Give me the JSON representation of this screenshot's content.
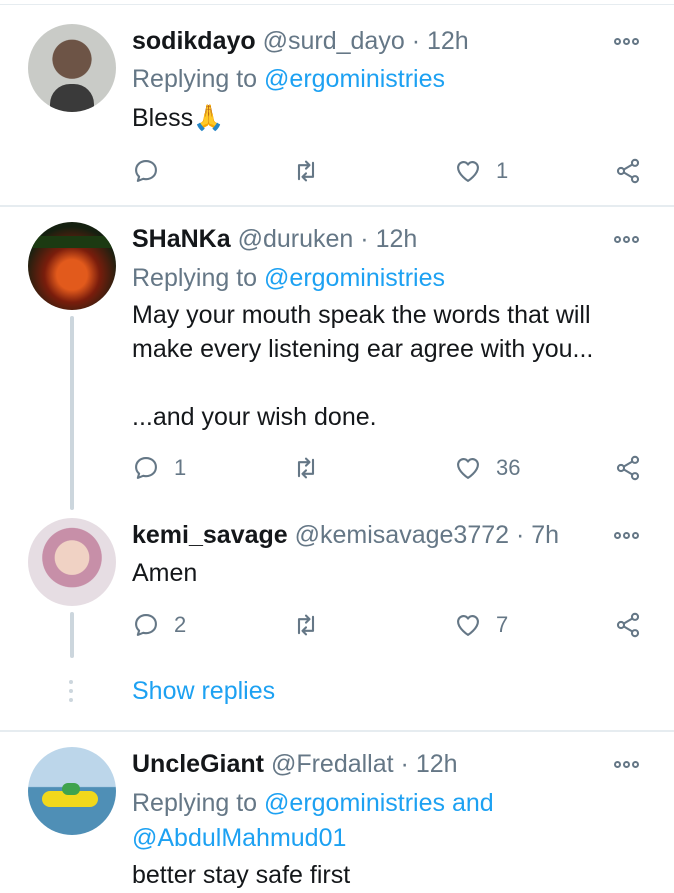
{
  "colors": {
    "accent": "#1da1f2",
    "muted": "#657786",
    "text": "#14171a",
    "border": "#e6ecf0"
  },
  "icons": {
    "reply": "speech-bubble-icon",
    "retweet": "retweet-arrows-icon",
    "like": "heart-outline-icon",
    "share": "share-nodes-icon",
    "more": "three-dots-icon"
  },
  "tweets": [
    {
      "name": "sodikdayo",
      "handle": "@surd_dayo",
      "sep": "·",
      "time": "12h",
      "replying_prefix": "Replying to",
      "replying_to": "@ergoministries",
      "text": "Bless🙏",
      "reply_count": "",
      "like_count": "1"
    },
    {
      "name": "SHaNKa",
      "handle": "@duruken",
      "sep": "·",
      "time": "12h",
      "replying_prefix": "Replying to",
      "replying_to": "@ergoministries",
      "text": "May your mouth speak the words that will make every listening ear agree with you...\n\n...and your wish done.",
      "reply_count": "1",
      "like_count": "36"
    },
    {
      "name": "kemi_savage",
      "handle": "@kemisavage3772",
      "sep": "·",
      "time": "7h",
      "text": "Amen",
      "reply_count": "2",
      "like_count": "7"
    },
    {
      "name": "UncleGiant",
      "handle": "@Fredallat",
      "sep": "·",
      "time": "12h",
      "replying_prefix": "Replying to",
      "replying_to": "@ergoministries and",
      "replying_to_2": "@AbdulMahmud01",
      "text": "better stay safe first"
    }
  ],
  "show_replies_label": "Show replies"
}
